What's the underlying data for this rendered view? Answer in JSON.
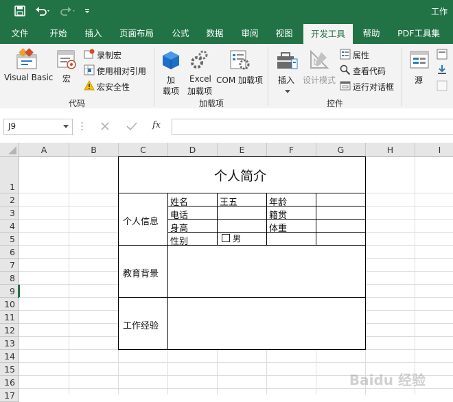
{
  "window": {
    "title": "工作"
  },
  "menu": {
    "tabs": [
      {
        "label": "文件"
      },
      {
        "label": "开始"
      },
      {
        "label": "插入"
      },
      {
        "label": "页面布局"
      },
      {
        "label": "公式"
      },
      {
        "label": "数据"
      },
      {
        "label": "审阅"
      },
      {
        "label": "视图"
      },
      {
        "label": "开发工具",
        "active": true
      },
      {
        "label": "帮助"
      },
      {
        "label": "PDF工具集"
      }
    ]
  },
  "ribbon": {
    "code": {
      "group_label": "代码",
      "visual_basic": "Visual Basic",
      "macros": "宏",
      "record_macro": "录制宏",
      "relative_ref": "使用相对引用",
      "macro_security": "宏安全性"
    },
    "addins": {
      "group_label": "加载项",
      "addins_line1": "加",
      "addins_line2": "载项",
      "excel_addins_line1": "Excel",
      "excel_addins_line2": "加载项",
      "com_addins": "COM 加载项"
    },
    "controls": {
      "group_label": "控件",
      "insert": "插入",
      "design_mode": "设计模式",
      "properties": "属性",
      "view_code": "查看代码",
      "run_dialog": "运行对话框"
    },
    "xml": {
      "source": "源"
    }
  },
  "formula_bar": {
    "name_box": "J9",
    "fx": "fx",
    "formula": ""
  },
  "grid": {
    "columns": [
      "A",
      "B",
      "C",
      "D",
      "E",
      "F",
      "G",
      "H",
      "I"
    ],
    "rows": [
      "1",
      "2",
      "3",
      "4",
      "5",
      "6",
      "7",
      "8",
      "9",
      "10",
      "11",
      "12",
      "13",
      "14",
      "15",
      "16",
      "17"
    ]
  },
  "sheet": {
    "title": "个人简介",
    "personal_info": "个人信息",
    "name_label": "姓名",
    "name_value": "王五",
    "age_label": "年龄",
    "phone_label": "电话",
    "native_label": "籍贯",
    "height_label": "身高",
    "weight_label": "体重",
    "gender_label": "性别",
    "gender_checkbox_label": "男",
    "gender_checked": false,
    "education": "教育背景",
    "work": "工作经验"
  },
  "watermark": "Baidu 经验",
  "colors": {
    "excel_green": "#217346",
    "ribbon_bg": "#f3f3f3",
    "header_bg": "#e6e6e6"
  }
}
